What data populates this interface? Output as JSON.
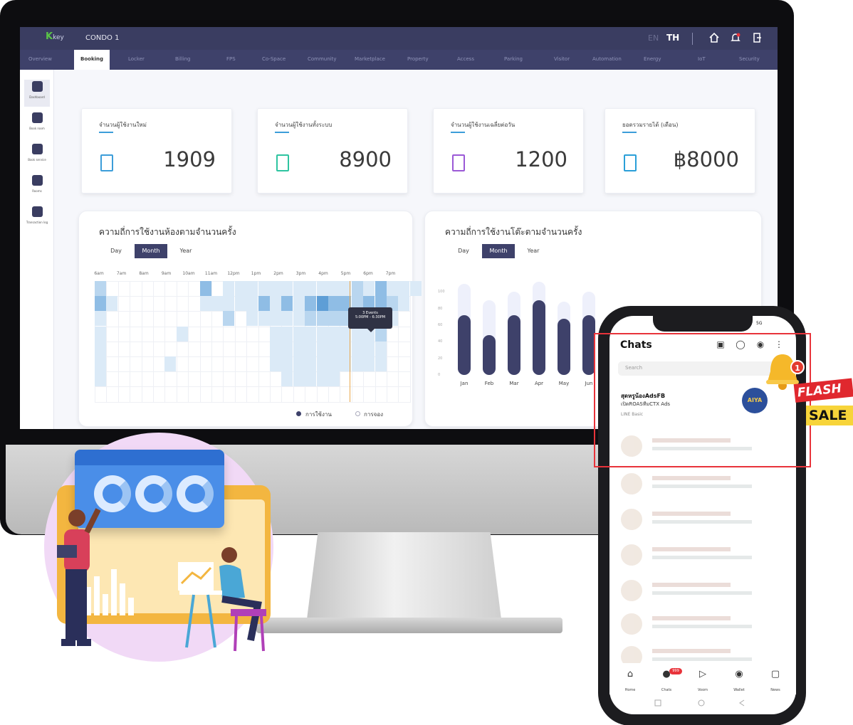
{
  "header": {
    "logo_mark": "K",
    "logo_text": "key",
    "app_title": "CONDO 1",
    "lang_en": "EN",
    "lang_th": "TH",
    "icons": [
      "home-icon",
      "bell-icon",
      "logout-icon"
    ]
  },
  "tabs": [
    {
      "label": "Overview",
      "active": false
    },
    {
      "label": "Booking",
      "active": true
    },
    {
      "label": "Locker",
      "active": false
    },
    {
      "label": "Billing",
      "active": false
    },
    {
      "label": "FPS",
      "active": false
    },
    {
      "label": "Co-Space",
      "active": false
    },
    {
      "label": "Community",
      "active": false
    },
    {
      "label": "Marketplace",
      "active": false
    },
    {
      "label": "Property",
      "active": false
    },
    {
      "label": "Access",
      "active": false
    },
    {
      "label": "Parking",
      "active": false
    },
    {
      "label": "Visitor",
      "active": false
    },
    {
      "label": "Automation",
      "active": false
    },
    {
      "label": "Energy",
      "active": false
    },
    {
      "label": "IoT",
      "active": false
    },
    {
      "label": "Security",
      "active": false
    }
  ],
  "sidebar": {
    "items": [
      {
        "label": "Dashboard",
        "icon": "dashboard-icon",
        "active": true
      },
      {
        "label": "Book room",
        "icon": "room-icon",
        "active": false
      },
      {
        "label": "Book service",
        "icon": "service-icon",
        "active": false
      },
      {
        "label": "Rooms",
        "icon": "rooms-icon",
        "active": false
      },
      {
        "label": "Transaction log",
        "icon": "log-icon",
        "active": false
      }
    ]
  },
  "stats": [
    {
      "title": "จำนวนผู้ใช้งานใหม่",
      "value": "1909",
      "color": "#3c9dd9"
    },
    {
      "title": "จำนวนผู้ใช้งานทั้งระบบ",
      "value": "8900",
      "color": "#2ec4a0"
    },
    {
      "title": "จำนวนผู้ใช้งานเฉลี่ยต่อวัน",
      "value": "1200",
      "color": "#9b59d6"
    },
    {
      "title": "ยอดรวมรายได้ (เดือน)",
      "value": "฿8000",
      "color": "#2a9fd8"
    }
  ],
  "heatmap_card": {
    "title": "ความถี่การใช้งานห้องตามจำนวนครั้ง",
    "segments": [
      "Day",
      "Month",
      "Year"
    ],
    "active_segment": "Month",
    "hours": [
      "6am",
      "7am",
      "8am",
      "9am",
      "10am",
      "11am",
      "12pm",
      "1pm",
      "2pm",
      "3pm",
      "4pm",
      "5pm",
      "6pm",
      "7pm"
    ],
    "tooltip_title": "3 Events",
    "tooltip_sub": "5:00PM - 6:30PM",
    "legend": [
      "การใช้งาน",
      "การจอง"
    ]
  },
  "bar_card": {
    "title": "ความถี่การใช้งานโต๊ะตามจำนวนครั้ง",
    "segments": [
      "Day",
      "Month",
      "Year"
    ],
    "active_segment": "Month"
  },
  "chart_data": {
    "type": "bar",
    "categories": [
      "Jan",
      "Feb",
      "Mar",
      "Apr",
      "May",
      "Jun"
    ],
    "series": [
      {
        "values": [
          72,
          48,
          72,
          90,
          68,
          72
        ]
      },
      {
        "values": [
          110,
          90,
          100,
          112,
          88,
          100
        ]
      }
    ],
    "ylim": [
      0,
      120
    ],
    "grid": true
  },
  "phone": {
    "status": "5G",
    "title": "Chats",
    "search_placeholder": "Search",
    "chat1_name": "สุดหรูน้องAdsFB",
    "chat1_sub": "เปิดROASทีมCTX Ads",
    "chat1_meta": "LINE Basic",
    "avatar_text": "AIYA",
    "nav": [
      {
        "label": "Home",
        "icon": "home-icon"
      },
      {
        "label": "Chats",
        "icon": "chat-icon"
      },
      {
        "label": "Voom",
        "icon": "voom-icon"
      },
      {
        "label": "Wallet",
        "icon": "wallet-icon"
      },
      {
        "label": "News",
        "icon": "news-icon"
      }
    ],
    "chat_badge": "999"
  },
  "promo": {
    "bell_count": "1",
    "flash": "FLASH",
    "sale": "SALE"
  }
}
